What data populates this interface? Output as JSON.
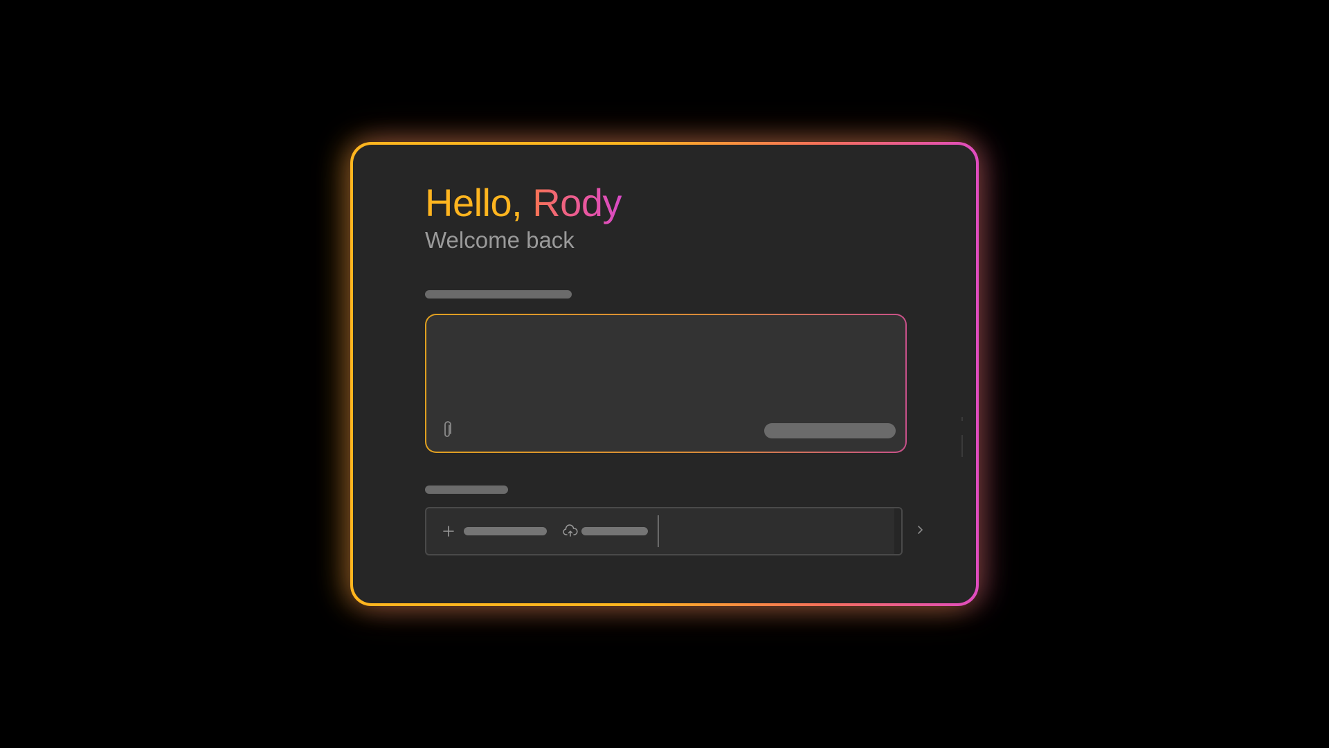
{
  "greeting": {
    "hello": "Hello,",
    "name": "Rody",
    "subtitle": "Welcome back"
  },
  "prompt": {
    "attach_icon": "paperclip-icon",
    "value": ""
  },
  "chips": [
    {
      "icon": "plus-icon"
    },
    {
      "icon": "cloud-upload-icon"
    }
  ],
  "navigation": {
    "next_icon": "chevron-right-icon"
  },
  "colors": {
    "background": "#000000",
    "card": "#262626",
    "accent_yellow": "#ffb51f",
    "accent_coral": "#f77452",
    "accent_magenta": "#d84ac6",
    "skeleton": "#6b6b6b",
    "subtitle": "#9a9a9a"
  }
}
